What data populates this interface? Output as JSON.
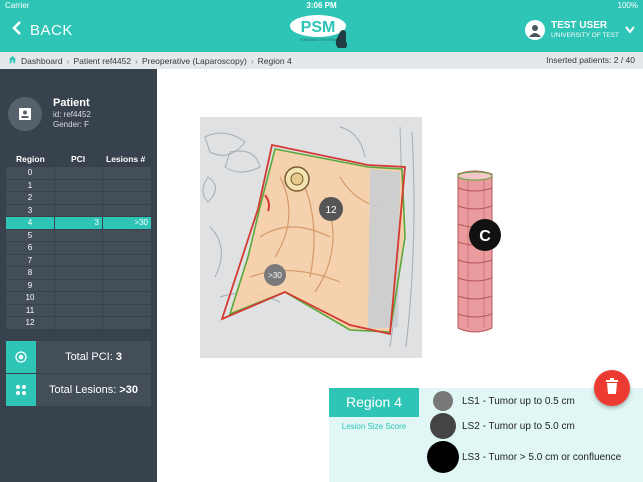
{
  "status": {
    "carrier": "Carrier",
    "time": "3:06 PM",
    "battery": "100%"
  },
  "header": {
    "back_label": "BACK",
    "logo_text": "PSM",
    "logo_subtext": "STAGING SYSTEM",
    "user_name": "TEST USER",
    "user_org": "UNIVERSITY OF TEST"
  },
  "breadcrumb": {
    "items": [
      "Dashboard",
      "Patient ref4452",
      "Preoperative (Laparoscopy)",
      "Region 4"
    ],
    "inserted": "Inserted patients: 2 / 40"
  },
  "patient": {
    "title": "Patient",
    "id": "id: ref4452",
    "gender": "Gender: F"
  },
  "table": {
    "headers": [
      "Region",
      "PCI",
      "Lesions #"
    ],
    "rows": [
      {
        "region": "0",
        "pci": "",
        "lesions": ""
      },
      {
        "region": "1",
        "pci": "",
        "lesions": ""
      },
      {
        "region": "2",
        "pci": "",
        "lesions": ""
      },
      {
        "region": "3",
        "pci": "",
        "lesions": ""
      },
      {
        "region": "4",
        "pci": "3",
        "lesions": ">30"
      },
      {
        "region": "5",
        "pci": "",
        "lesions": ""
      },
      {
        "region": "6",
        "pci": "",
        "lesions": ""
      },
      {
        "region": "7",
        "pci": "",
        "lesions": ""
      },
      {
        "region": "8",
        "pci": "",
        "lesions": ""
      },
      {
        "region": "9",
        "pci": "",
        "lesions": ""
      },
      {
        "region": "10",
        "pci": "",
        "lesions": ""
      },
      {
        "region": "11",
        "pci": "",
        "lesions": ""
      },
      {
        "region": "12",
        "pci": "",
        "lesions": ""
      }
    ],
    "active_region": "4"
  },
  "totals": {
    "pci_label": "Total PCI:",
    "pci_value": "3",
    "lesions_label": "Total Lesions:",
    "lesions_value": ">30"
  },
  "figure": {
    "marker_12": "12",
    "marker_30": ">30",
    "marker_c": "C"
  },
  "legend": {
    "region_title": "Region 4",
    "subtitle": "Lesion Size Score",
    "items": [
      {
        "label": "LS1 - Tumor up to 0.5 cm",
        "color": "#777777"
      },
      {
        "label": "LS2 - Tumor up to 5.0 cm",
        "color": "#444444"
      },
      {
        "label": "LS3 - Tumor > 5.0 cm or confluence",
        "color": "#000000"
      }
    ]
  },
  "colors": {
    "accent": "#2ec4b6",
    "sidebar": "#38424c",
    "delete": "#ee3b32"
  },
  "icons": {
    "back": "chevron-left-icon",
    "user": "user-avatar-icon",
    "dropdown": "chevron-down-icon",
    "home": "home-icon",
    "patient": "id-card-icon",
    "pci": "target-icon",
    "lesions": "cluster-icon",
    "delete": "trash-icon"
  }
}
